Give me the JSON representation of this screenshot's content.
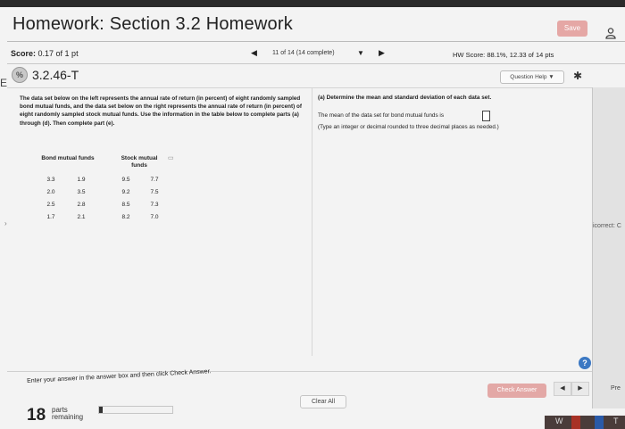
{
  "header": {
    "title": "Homework: Section 3.2 Homework",
    "save_label": "Save"
  },
  "status": {
    "score_label": "Score:",
    "score_value": "0.17 of 1 pt",
    "question_count": "11 of 14 (14 complete)",
    "hw_score": "HW Score: 88.1%, 12.33 of 14 pts"
  },
  "question": {
    "number": "3.2.46-T",
    "badge": "%",
    "help_label": "Question Help ▼",
    "description": "The data set below on the left represents the annual rate of return (in percent) of eight randomly sampled bond mutual funds, and the data set below on the right represents the annual rate of return (in percent) of eight randomly sampled stock mutual funds. Use the information in the table below to complete parts (a) through (d). Then complete part (e).",
    "table": {
      "header_bond": "Bond mutual funds",
      "header_stock": "Stock mutual funds",
      "bond": [
        [
          "3.3",
          "1.9"
        ],
        [
          "2.0",
          "3.5"
        ],
        [
          "2.5",
          "2.8"
        ],
        [
          "1.7",
          "2.1"
        ]
      ],
      "stock": [
        [
          "9.5",
          "7.7"
        ],
        [
          "9.2",
          "7.5"
        ],
        [
          "8.5",
          "7.3"
        ],
        [
          "8.2",
          "7.0"
        ]
      ]
    },
    "part_a": "(a) Determine the mean and standard deviation of each data set.",
    "answer_prompt": "The mean of the data set for bond mutual funds is",
    "type_hint": "(Type an integer or decimal rounded to three decimal places as needed.)"
  },
  "side_panel": {
    "text": "icorrect: C"
  },
  "footer": {
    "enter_text": "Enter your answer in the answer box and then click Check Answer.",
    "clear_label": "Clear All",
    "check_label": "Check Answer",
    "pre_label": "Pre",
    "parts_count": "18",
    "parts_line1": "parts",
    "parts_line2": "remaining",
    "progress_fraction": 0.05
  },
  "colors": {
    "accent_button": "#e3a8a6",
    "help_blue": "#3b78c3"
  }
}
